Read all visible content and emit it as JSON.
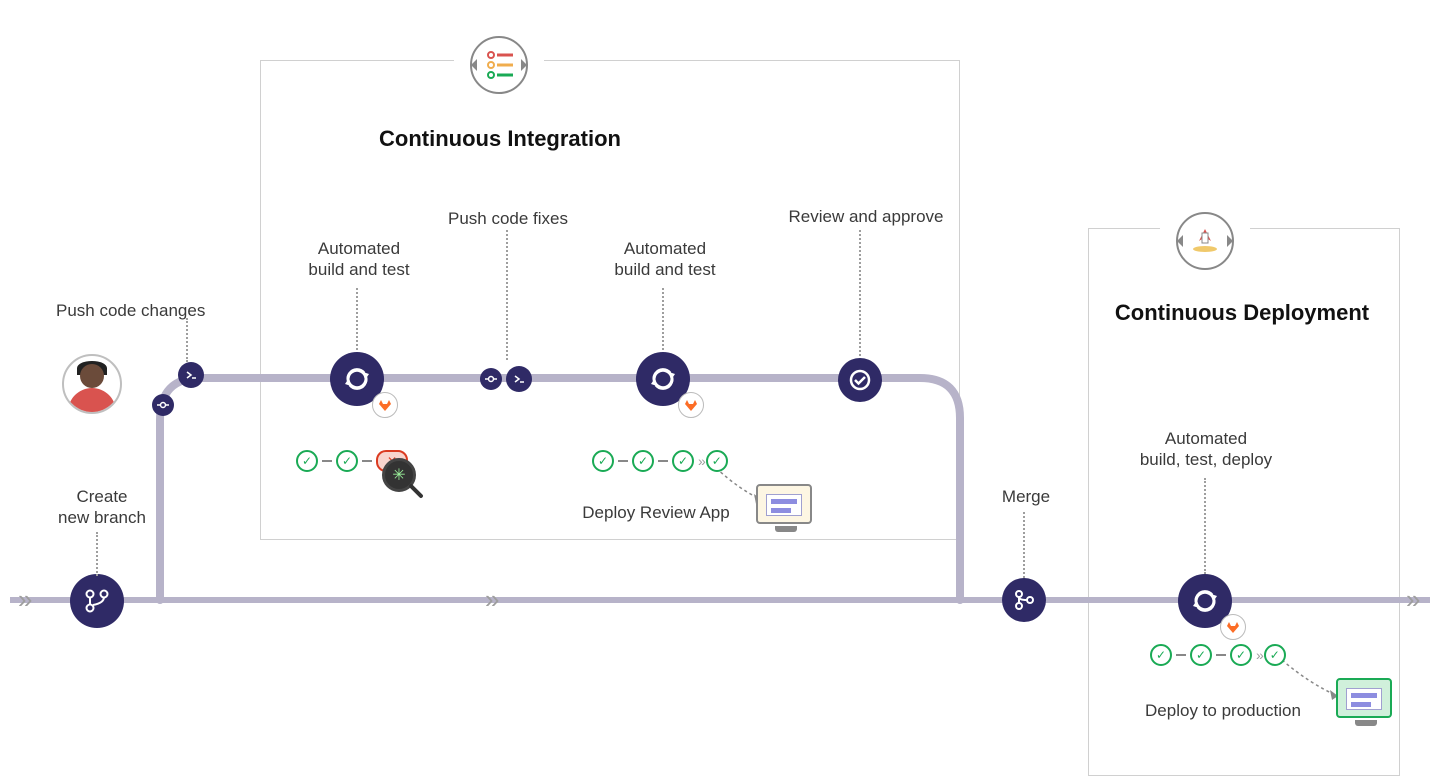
{
  "sections": {
    "ci": {
      "title": "Continuous Integration"
    },
    "cd": {
      "title": "Continuous Deployment"
    }
  },
  "labels": {
    "create_branch": "Create\nnew branch",
    "push_changes": "Push code changes",
    "build_test_1": "Automated\nbuild and test",
    "push_fixes": "Push code fixes",
    "build_test_2": "Automated\nbuild and test",
    "review_approve": "Review and approve",
    "deploy_review_app": "Deploy Review App",
    "merge": "Merge",
    "build_test_deploy": "Automated\nbuild, test, deploy",
    "deploy_prod": "Deploy to production"
  },
  "steps": {
    "create_branch": {
      "icon": "branch"
    },
    "push_changes_commit": {
      "icon": "commit"
    },
    "push_changes_push": {
      "icon": "push"
    },
    "ci_cycle_1": {
      "icon": "cycle",
      "status": [
        "ok",
        "ok",
        "fail"
      ]
    },
    "push_fixes_commit": {
      "icon": "commit"
    },
    "push_fixes_push": {
      "icon": "push"
    },
    "ci_cycle_2": {
      "icon": "cycle",
      "status": [
        "ok",
        "ok",
        "ok",
        "ok"
      ]
    },
    "review": {
      "icon": "check-badge"
    },
    "merge": {
      "icon": "merge"
    },
    "cd_cycle": {
      "icon": "cycle",
      "status": [
        "ok",
        "ok",
        "ok",
        "ok"
      ]
    }
  },
  "colors": {
    "node": "#2f2a66",
    "timeline": "#9e9e9e",
    "ok": "#1aaa55",
    "fail": "#db3b21",
    "gitlab": "#fc6d26"
  }
}
